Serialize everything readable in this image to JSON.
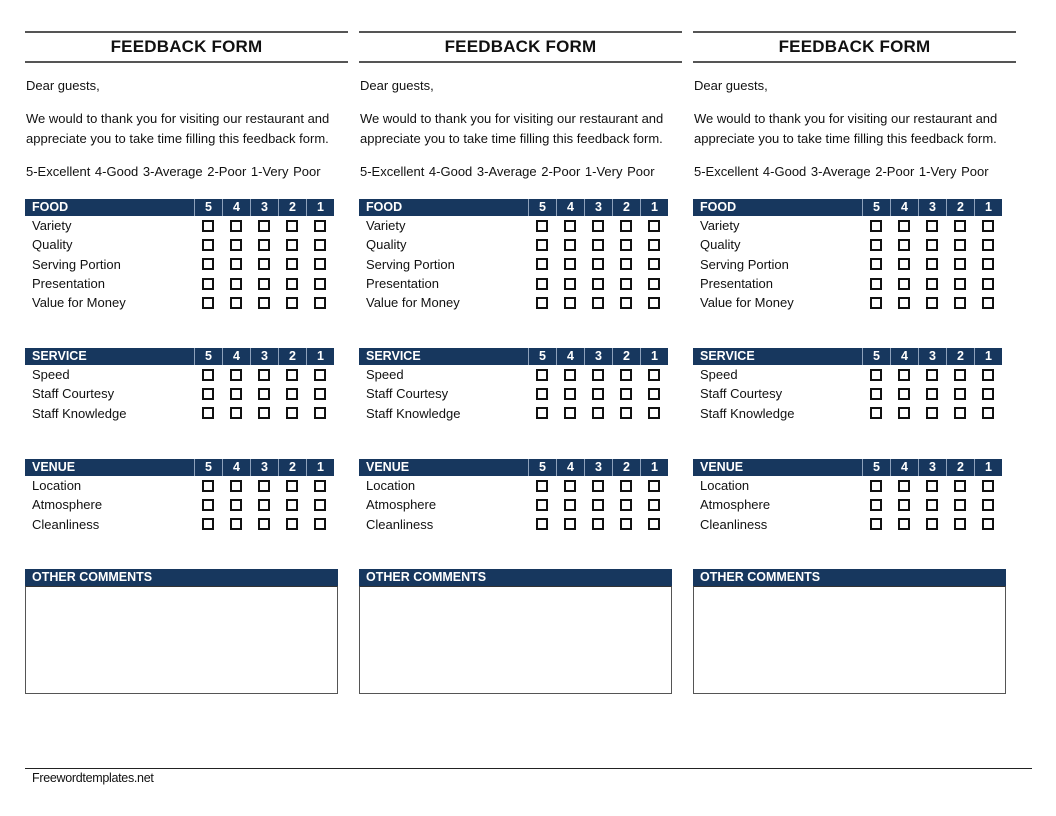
{
  "forms": [
    {
      "title": "FEEDBACK FORM",
      "greeting": "Dear guests,",
      "intro": "We would to thank you for visiting our restaurant and appreciate you to take time filling this feedback form.",
      "scale_legend": "5-Excellent 4-Good 3-Average 2-Poor 1-Very Poor"
    },
    {
      "title": "FEEDBACK FORM",
      "greeting": "Dear guests,",
      "intro": "We would to thank you for visiting our restaurant and appreciate you to take time filling this feedback form.",
      "scale_legend": "5-Excellent 4-Good 3-Average 2-Poor 1-Very Poor"
    },
    {
      "title": "FEEDBACK FORM",
      "greeting": "Dear guests,",
      "intro": "We would to thank you for visiting our restaurant and appreciate you to take time filling this feedback form.",
      "scale_legend": "5-Excellent 4-Good 3-Average 2-Poor 1-Very Poor"
    }
  ],
  "rating_columns": [
    "5",
    "4",
    "3",
    "2",
    "1"
  ],
  "sections": [
    {
      "key": "food",
      "title": "FOOD",
      "items": [
        "Variety",
        "Quality",
        "Serving Portion",
        "Presentation",
        "Value for Money"
      ]
    },
    {
      "key": "service",
      "title": "SERVICE",
      "items": [
        "Speed",
        "Staff Courtesy",
        "Staff Knowledge"
      ]
    },
    {
      "key": "venue",
      "title": "VENUE",
      "items": [
        "Location",
        "Atmosphere",
        "Cleanliness"
      ]
    }
  ],
  "comments": {
    "title": "OTHER COMMENTS",
    "value": ""
  },
  "footer": {
    "text": "Freewordtemplates.net"
  },
  "colors": {
    "header_bg": "#17375e",
    "header_text": "#ffffff"
  }
}
